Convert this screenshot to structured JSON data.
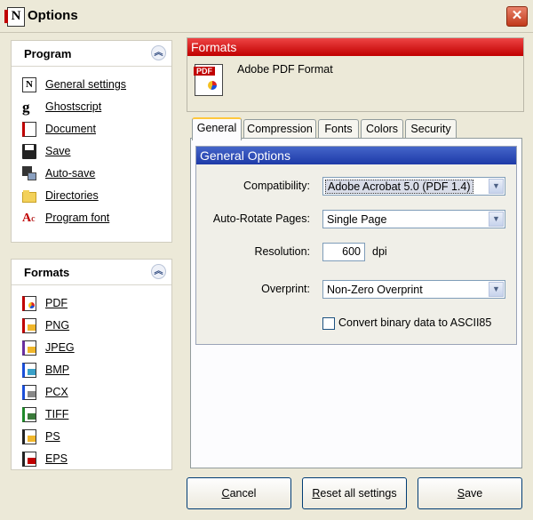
{
  "window": {
    "title": "Options",
    "close_label": "✕"
  },
  "program_panel": {
    "title": "Program",
    "items": [
      {
        "label": "General settings",
        "icon": "document-n-icon"
      },
      {
        "label": "Ghostscript",
        "icon": "ghostscript-icon"
      },
      {
        "label": "Document",
        "icon": "document-icon"
      },
      {
        "label": "Save",
        "icon": "floppy-disk-icon"
      },
      {
        "label": "Auto-save",
        "icon": "auto-save-icon"
      },
      {
        "label": "Directories",
        "icon": "folder-icon"
      },
      {
        "label": "Program font",
        "icon": "font-icon"
      }
    ]
  },
  "formats_panel": {
    "title": "Formats",
    "items": [
      {
        "label": "PDF",
        "icon": "pdf-file-icon"
      },
      {
        "label": "PNG",
        "icon": "png-file-icon"
      },
      {
        "label": "JPEG",
        "icon": "jpeg-file-icon"
      },
      {
        "label": "BMP",
        "icon": "bmp-file-icon"
      },
      {
        "label": "PCX",
        "icon": "pcx-file-icon"
      },
      {
        "label": "TIFF",
        "icon": "tiff-file-icon"
      },
      {
        "label": "PS",
        "icon": "ps-file-icon"
      },
      {
        "label": "EPS",
        "icon": "eps-file-icon"
      }
    ]
  },
  "formats_header": {
    "title": "Formats",
    "format_name": "Adobe PDF Format",
    "icon_tag": "PDF"
  },
  "tabs": [
    {
      "label": "General",
      "active": true
    },
    {
      "label": "Compression"
    },
    {
      "label": "Fonts"
    },
    {
      "label": "Colors"
    },
    {
      "label": "Security"
    }
  ],
  "general_options": {
    "title": "General Options",
    "compatibility": {
      "label": "Compatibility:",
      "value": "Adobe Acrobat 5.0 (PDF 1.4)"
    },
    "auto_rotate": {
      "label": "Auto-Rotate Pages:",
      "value": "Single Page"
    },
    "resolution": {
      "label": "Resolution:",
      "value": "600",
      "unit": "dpi"
    },
    "overprint": {
      "label": "Overprint:",
      "value": "Non-Zero Overprint"
    },
    "ascii85": {
      "label": "Convert binary data to ASCII85",
      "checked": false
    }
  },
  "buttons": {
    "cancel": {
      "mnemonic": "C",
      "rest": "ancel"
    },
    "reset": {
      "mnemonic": "R",
      "rest": "eset all settings"
    },
    "save": {
      "mnemonic": "S",
      "rest": "ave"
    }
  },
  "colors": {
    "header_red": "#c00000",
    "header_blue": "#1e3aa8",
    "background": "#ece9d8"
  }
}
